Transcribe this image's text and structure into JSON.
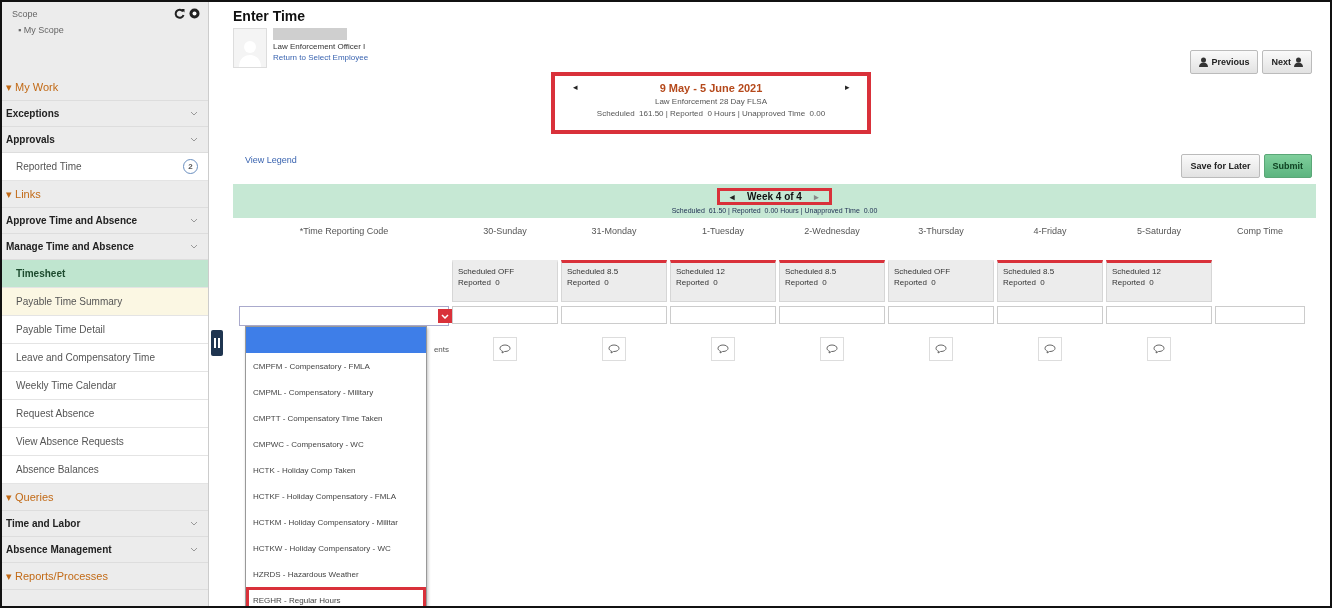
{
  "sidebar": {
    "scope_label": "Scope",
    "scope_bullet": "▪",
    "scope_item": "My Scope",
    "sections": [
      {
        "marker": "▾",
        "label": "My Work",
        "groups": [
          {
            "label": "Exceptions"
          },
          {
            "label": "Approvals",
            "children": [
              {
                "label": "Reported Time",
                "badge": "2",
                "selected": false,
                "hovered": false
              }
            ]
          }
        ]
      },
      {
        "marker": "▾",
        "label": "Links",
        "groups": [
          {
            "label": "Approve Time and Absence"
          },
          {
            "label": "Manage Time and Absence",
            "children": [
              {
                "label": "Timesheet",
                "selected": true,
                "hovered": false
              },
              {
                "label": "Payable Time Summary",
                "selected": false,
                "hovered": true
              },
              {
                "label": "Payable Time Detail",
                "selected": false,
                "hovered": false
              },
              {
                "label": "Leave and Compensatory Time",
                "selected": false,
                "hovered": false
              },
              {
                "label": "Weekly Time Calendar",
                "selected": false,
                "hovered": false
              },
              {
                "label": "Request Absence",
                "selected": false,
                "hovered": false
              },
              {
                "label": "View Absence Requests",
                "selected": false,
                "hovered": false
              },
              {
                "label": "Absence Balances",
                "selected": false,
                "hovered": false
              }
            ]
          }
        ]
      },
      {
        "marker": "▾",
        "label": "Queries",
        "groups": [
          {
            "label": "Time and Labor"
          },
          {
            "label": "Absence Management"
          }
        ]
      },
      {
        "marker": "▾",
        "label": "Reports/Processes"
      }
    ]
  },
  "page": {
    "title": "Enter Time",
    "employee": {
      "job_title": "Law Enforcement Officer I",
      "return_link": "Return to Select Employee"
    },
    "buttons": {
      "previous": "Previous",
      "next": "Next",
      "save": "Save for Later",
      "submit": "Submit"
    },
    "period": {
      "prev": "◂",
      "next": "▸",
      "range": "9 May - 5 June 2021",
      "schedule": "Law Enforcement 28 Day FLSA",
      "totals": "Scheduled  161.50 | Reported  0 Hours | Unapproved Time  0.00",
      "highlighted": true
    },
    "legend_link": "View Legend",
    "week": {
      "prev": "◂",
      "label": "Week 4 of 4",
      "next": "▸",
      "totals": "Scheduled  61.50 | Reported  0.00 Hours | Unapproved Time  0.00",
      "highlighted": true
    },
    "columns": {
      "trc": "*Time Reporting Code",
      "days": [
        "30-Sunday",
        "31-Monday",
        "1-Tuesday",
        "2-Wednesday",
        "3-Thursday",
        "4-Friday",
        "5-Saturday"
      ],
      "extra": "Comp Time"
    },
    "day_cards": [
      {
        "scheduled": "Scheduled OFF",
        "reported": "Reported  0",
        "alert": false
      },
      {
        "scheduled": "Scheduled 8.5",
        "reported": "Reported  0",
        "alert": true
      },
      {
        "scheduled": "Scheduled 12",
        "reported": "Reported  0",
        "alert": true
      },
      {
        "scheduled": "Scheduled 8.5",
        "reported": "Reported  0",
        "alert": true
      },
      {
        "scheduled": "Scheduled OFF",
        "reported": "Reported  0",
        "alert": false
      },
      {
        "scheduled": "Scheduled 8.5",
        "reported": "Reported  0",
        "alert": true
      },
      {
        "scheduled": "Scheduled 12",
        "reported": "Reported  0",
        "alert": true
      }
    ],
    "hidden_text": "ents",
    "trc_dropdown": {
      "arrow_highlighted": true,
      "options": [
        {
          "selected": true,
          "highlighted": false
        },
        {
          "label": "CMPFM - Compensatory - FMLA",
          "selected": false,
          "highlighted": false
        },
        {
          "label": "CMPML - Compensatory - Military",
          "selected": false,
          "highlighted": false
        },
        {
          "label": "CMPTT - Compensatory Time Taken",
          "selected": false,
          "highlighted": false
        },
        {
          "label": "CMPWC - Compensatory - WC",
          "selected": false,
          "highlighted": false
        },
        {
          "label": "HCTK - Holiday Comp Taken",
          "selected": false,
          "highlighted": false
        },
        {
          "label": "HCTKF - Holiday Compensatory - FMLA",
          "selected": false,
          "highlighted": false
        },
        {
          "label": "HCTKM - Holiday Compensatory - Militar",
          "selected": false,
          "highlighted": false
        },
        {
          "label": "HCTKW - Holiday Compensatory - WC",
          "selected": false,
          "highlighted": false
        },
        {
          "label": "HZRDS - Hazardous Weather",
          "selected": false,
          "highlighted": false
        },
        {
          "label": "REGHR - Regular Hours",
          "selected": false,
          "highlighted": true
        }
      ]
    }
  }
}
